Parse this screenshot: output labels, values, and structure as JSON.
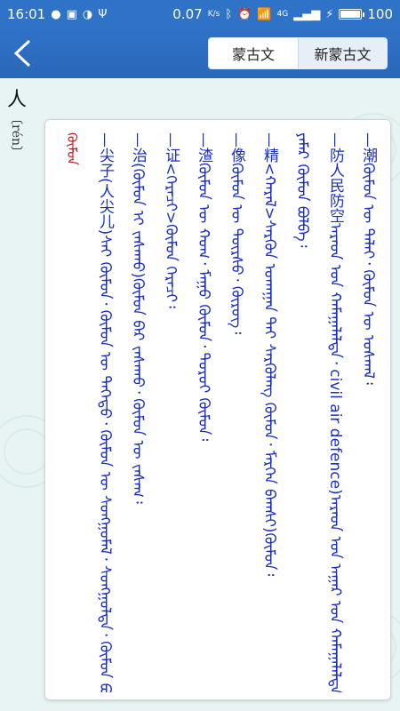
{
  "status_bar": {
    "time": "16:01",
    "speed": "0.07",
    "speed_unit": "K/s",
    "network": "4G",
    "battery": "100"
  },
  "toolbar": {
    "segments": [
      "蒙古文",
      "新蒙古文"
    ],
    "active_segment": 0
  },
  "entry": {
    "headword": "人",
    "pinyin": "〔rén〕",
    "lines": [
      {
        "text": "ᠬᠦᠮᠦᠨ",
        "color": "#c4131b"
      },
      {
        "text": "—尖子(人尖儿)ᠰᠠᠢ ᠬᠦᠮᠦᠨ᠂ ᠬᠦᠮᠦᠨ ᠦ ᠳᠡᠭᠡᠳᠦ᠂ ᠬᠦᠮᠦᠨ ᠦ ᠰᠣᠩᠭᠣᠮᠠᠯ᠂ ᠰᠣᠩᠭᠣᠯᠲᠠ᠂ ᠬᠦᠮᠦᠨ ᠪᠣᠯᠪᠠ ᠰᠡᠷᠭᠦᠨ ᠪᠦᠬᠦᠨ ᠬᠦᠮᠦᠨ ᠳᠡᠭᠡᠳᠦ᠄",
        "color": "#1b2fbf"
      },
      {
        "text": "—治(ᠬᠦᠮᠦᠨ ᠢ ᠵᠠᠰᠠᠬᠤ)ᠬᠦᠮᠦᠨ ᠪᠠᠷ ᠵᠠᠰᠠᠬᠤ᠂ ᠬᠦᠮᠦᠨ ᠦ ᠵᠠᠰᠠᠭ᠄",
        "color": "#1b2fbf"
      },
      {
        "text": "—证<ᠭᠡᠷᠡᠴᠢ>ᠬᠦᠮᠦᠨ ᠭᠡᠷᠡᠴᠢ᠄",
        "color": "#1b2fbf"
      },
      {
        "text": "—渣ᠬᠦᠮᠦᠨ ᠦ ᠬᠣᠭ᠂ ᠮᠠᠭᠤ ᠬᠦᠮᠦᠨ᠂ ᠳᠣᠷᠣᠢ ᠬᠦᠮᠦᠨ᠄",
        "color": "#1b2fbf"
      },
      {
        "text": "—像ᠬᠦᠮᠦᠨ ᠦ ᠳᠦᠷᠰᠦ᠂ ᠬᠥᠷᠥᠭ᠄",
        "color": "#1b2fbf"
      },
      {
        "text": "—精<ᠬᠠᠷᠠᠯ>ᠰᠡᠷᠭᠦᠨ ᠤᠬᠠᠭᠠᠨ ᠲᠠᠢ ᠰᠡᠷᠭᠦᠯᠡᠩ ᠬᠦᠮᠦᠨ᠂ ᠮᠡᠷᠭᠡᠨ ᠪᠠᠭᠰᠢ)ᠬᠦᠮᠦᠨ᠄",
        "color": "#1b2fbf"
      },
      {
        "text": "ᠶᠠᠮᠠᠷ ᠬᠦᠮᠦᠨ ᠪᠣᠯᠪᠠ᠄",
        "color": "#1b2fbf"
      },
      {
        "text": "—防人民防空ᠠᠷᠠᠳ ᠤᠨ ᠬᠠᠮᠠᠭᠠᠯᠠᠯᠲᠠ᠂ civil air defence)ᠠᠷᠠᠳ ᠤᠨ ᠠᠭᠠᠷ ᠤᠨ ᠬᠠᠮᠠᠭᠠᠯᠠᠯᠲᠠ᠂ ᠬᠦᠮᠦᠨ ᠦ ᠰᠡᠷᠭᠦᠯᠡᠩ",
        "color": "#1b2fbf"
      },
      {
        "text": "—潮ᠬᠦᠮᠦᠨ ᠦ ᠳᠠᠯᠠᠢ᠂ ᠬᠦᠮᠦᠨ ᠦ ᠤᠰᠬᠠᠯ᠄",
        "color": "#1b2fbf"
      }
    ]
  },
  "colors": {
    "app_bar": "#2f73c9",
    "background": "#e8f4f3",
    "card": "#ffffff",
    "text_blue": "#1b2fbf",
    "text_red": "#c4131b"
  },
  "icons": {
    "back": "chevron-left-icon",
    "wechat": "wechat-icon",
    "gallery": "image-icon",
    "wifi": "wifi-icon",
    "alarm": "alarm-icon",
    "usb": "usb-icon"
  }
}
